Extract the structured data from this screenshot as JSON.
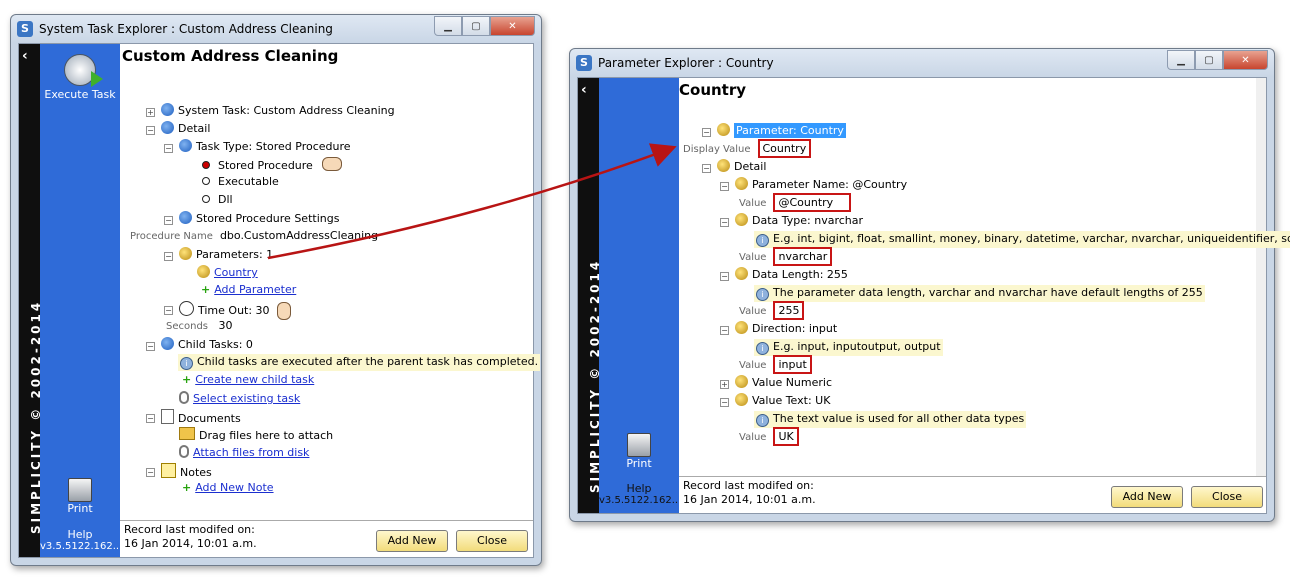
{
  "win1": {
    "title": "System Task Explorer : Custom Address Cleaning",
    "side": {
      "brand": "SIMPLICITY © 2002-2014",
      "execute": "Execute Task",
      "print": "Print",
      "help": "Help",
      "version": "v3.5.5122.162..."
    },
    "heading": "Custom Address Cleaning",
    "tree": {
      "system_task": "System Task:  Custom Address Cleaning",
      "detail": "Detail",
      "task_type": "Task Type:  Stored Procedure",
      "opt_stored": "Stored Procedure",
      "opt_exec": "Executable",
      "opt_dll": "Dll",
      "sp_settings": "Stored Procedure Settings",
      "proc_name_label": "Procedure Name",
      "proc_name_value": "dbo.CustomAddressCleaning",
      "parameters": "Parameters:  1",
      "country": "Country",
      "add_parameter": "Add Parameter",
      "timeout": "Time Out:  30",
      "seconds_label": "Seconds",
      "seconds_value": "30",
      "child_tasks": "Child Tasks:  0",
      "child_info": "Child tasks are executed after the parent task has completed.",
      "create_child": "Create new child task",
      "select_existing": "Select existing task",
      "documents": "Documents",
      "drag_files": "Drag files here to attach",
      "attach_files": "Attach files from disk",
      "notes": "Notes",
      "add_note": "Add New Note"
    },
    "footer": {
      "record1": "Record last modifed on:",
      "record2": "16 Jan 2014, 10:01 a.m.",
      "add_new": "Add New",
      "close": "Close"
    }
  },
  "win2": {
    "title": "Parameter Explorer : Country",
    "side": {
      "brand": "SIMPLICITY © 2002-2014",
      "print": "Print",
      "help": "Help",
      "version": "v3.5.5122.162..."
    },
    "heading": "Country",
    "tree": {
      "parameter": "Parameter:  Country",
      "display_value_label": "Display Value",
      "display_value": "Country",
      "detail": "Detail",
      "param_name": "Parameter Name:  @Country",
      "value_label": "Value",
      "param_name_value": "@Country",
      "data_type": "Data Type:  nvarchar",
      "data_type_info": "E.g. int, bigint, float, smallint, money, binary, datetime, varchar, nvarchar, uniqueidentifier, sql_variant",
      "data_type_value": "nvarchar",
      "data_length": "Data Length:  255",
      "data_length_info": "The parameter data length, varchar and nvarchar have default lengths of 255",
      "data_length_value": "255",
      "direction": "Direction:  input",
      "direction_info": "E.g. input, inputoutput, output",
      "direction_value": "input",
      "value_numeric": "Value Numeric",
      "value_text": "Value Text:  UK",
      "value_text_info": "The text value is used for all other data types",
      "value_text_value": "UK"
    },
    "footer": {
      "record1": "Record last modifed on:",
      "record2": "16 Jan 2014, 10:01 a.m.",
      "add_new": "Add New",
      "close": "Close"
    }
  },
  "colors": {
    "accent_blue": "#2f6bd8",
    "link": "#1b2fcf",
    "highlight_box": "#c81515",
    "arrow": "#b81414"
  }
}
